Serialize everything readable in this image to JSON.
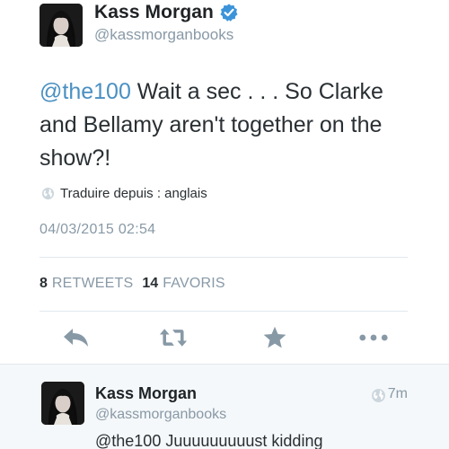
{
  "tweet": {
    "author": {
      "display_name": "Kass Morgan",
      "handle": "@kassmorganbooks",
      "verified": true
    },
    "text": {
      "mention": "@the100",
      "body": " Wait a sec . . . So Clarke and Bellamy aren't together on the show?!"
    },
    "translate_label": "Traduire depuis : anglais",
    "timestamp": "04/03/2015 02:54",
    "stats": {
      "retweets_count": "8",
      "retweets_label": "RETWEETS",
      "favorites_count": "14",
      "favorites_label": "FAVORIS"
    },
    "actions": {
      "reply_icon": "reply-arrow-icon",
      "retweet_icon": "retweet-icon",
      "favorite_icon": "star-icon",
      "more_icon": "more-dots-icon"
    }
  },
  "reply": {
    "display_name": "Kass Morgan",
    "handle": "@kassmorganbooks",
    "time": "7m",
    "text": "@the100 Juuuuuuuuust kidding"
  },
  "colors": {
    "link": "#4a90c2",
    "verified": "#3b94d9",
    "muted": "#8899a6",
    "action_icon": "#8899a6",
    "reply_background": "#f5f8fa"
  }
}
